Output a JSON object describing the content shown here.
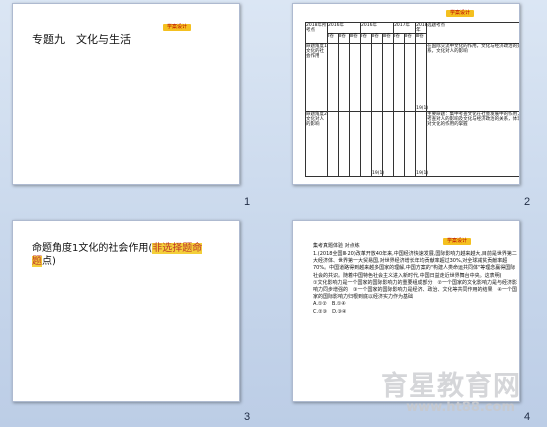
{
  "slides": [
    {
      "number": "1",
      "title": "专题九　文化与生活",
      "tag": "学案设计"
    },
    {
      "number": "2",
      "tag": "学案设计",
      "table": {
        "header": [
          "2018年所考点",
          "2016年",
          "2016年",
          "2017年",
          "2018年",
          "选题考点"
        ],
        "sub": [
          "Ⅰ卷",
          "Ⅱ卷",
          "Ⅲ卷",
          "Ⅰ卷",
          "Ⅱ卷",
          "Ⅲ卷",
          "Ⅰ卷",
          "Ⅱ卷",
          "Ⅲ卷"
        ],
        "rows": [
          {
            "label": "命题角度1文化的社会作用",
            "marks": [
              "",
              "",
              "",
              "",
              "",
              "",
              "",
              "",
              "19(1)"
            ],
            "note": "在国际交流中文化的作用，文化与经济政治的关系，文化对人的影响"
          },
          {
            "label": "命题角度2文化对人的影响",
            "marks": [
              "",
              "",
              "",
              "",
              "19(1)",
              "",
              "",
              "",
              "19(1)"
            ],
            "note": "主要命题：集中考查文化在社会发展中的作用，考查对人的影响及文化与经济政治的关系，体现对文化的作用的掌握"
          }
        ]
      }
    },
    {
      "number": "3",
      "title_prefix": "命题角度1文化的社会作用(",
      "title_highlight": "非选择题命题",
      "title_suffix": "点)"
    },
    {
      "number": "4",
      "tag": "学案设计",
      "header": "集考真题体验 对点练",
      "question": "1.(2018全国Ⅲ·20)改革开放40年来,中国经济快速发展,国际影响力越来越大,目前是世界第二大经济体、世界第一大贸易国,对世界经济增长年均贡献率超过30%,对全球减贫贡献率超70%。中国道路得到越来越多国家的理解,中国方案的\"构建人类命运共同体\"等理念赢得国际社会的共识。随着中国特色社会主义进入新时代,中国日益走近世界舞台中央。这表明(",
      "options_text": "①文化影响力是一个国家的国际影响力的重要组成部分　②一个国家的文化影响力是与经济影响力同步增强的　③一个国家的国际影响力是经济、政治、文化等共同作用的结果　④一个国家的国际影响力归根到底以经济实力作为基础",
      "choices": [
        "A.①②",
        "B.①④",
        "C.②③",
        "D.③④"
      ]
    }
  ],
  "watermark": {
    "brand": "育星教育网",
    "url": "www.ht88.com"
  },
  "colors": {
    "highlight": "#f3cf3a",
    "tag": "#f4c020",
    "accent_text": "#c0392b"
  }
}
